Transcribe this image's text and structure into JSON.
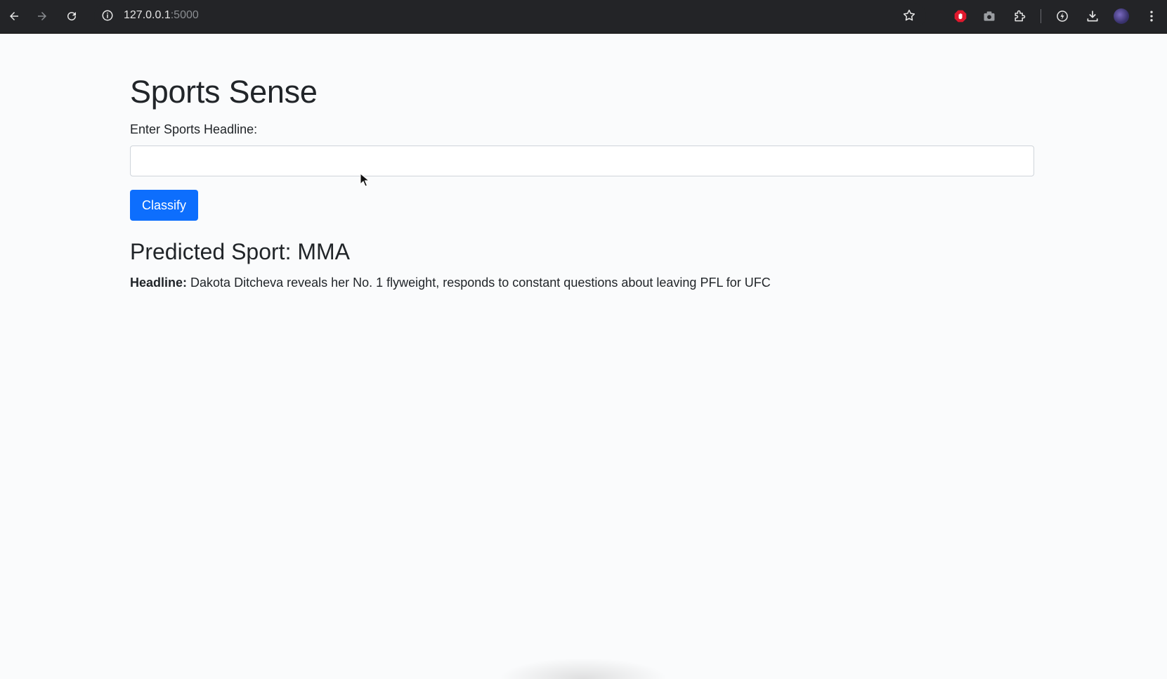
{
  "browser": {
    "url_host": "127.0.0.1",
    "url_port": ":5000",
    "icons": [
      "back-arrow-icon",
      "forward-arrow-icon",
      "reload-icon",
      "site-info-icon",
      "bookmark-star-icon",
      "adblock-extension-icon",
      "camera-extension-icon",
      "puzzle-extensions-icon",
      "performance-icon",
      "download-icon",
      "profile-avatar",
      "more-menu-icon"
    ]
  },
  "page": {
    "title": "Sports Sense",
    "input_label": "Enter Sports Headline:",
    "input_value": "",
    "classify_label": "Classify",
    "result_prefix": "Predicted Sport: ",
    "predicted_sport": "MMA",
    "headline_label": "Headline:",
    "headline_text": " Dakota Ditcheva reveals her No. 1 flyweight, responds to constant questions about leaving PFL for UFC"
  },
  "colors": {
    "browser_bar": "#232427",
    "page_bg": "#fafbfc",
    "primary_button": "#0d6efd",
    "text": "#212529"
  }
}
